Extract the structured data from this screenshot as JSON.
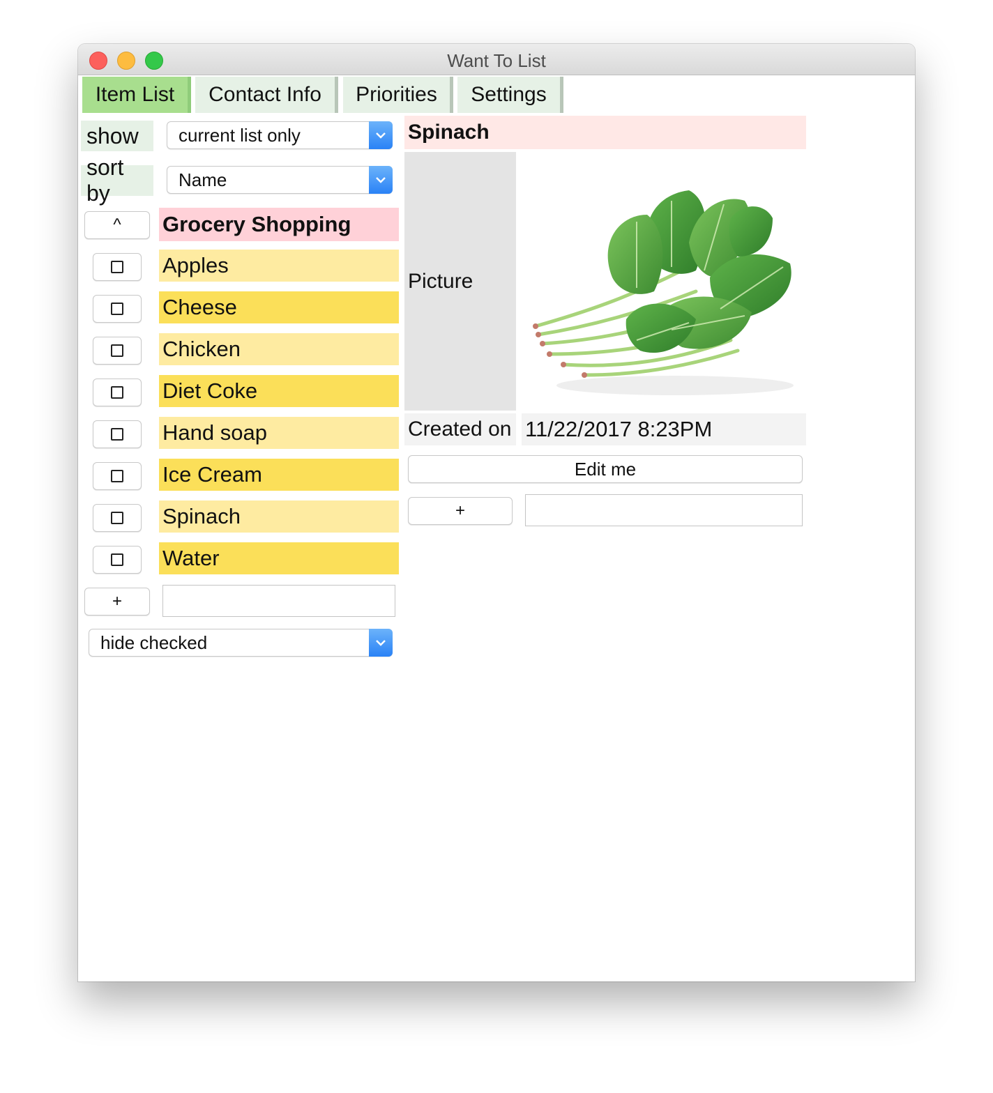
{
  "window": {
    "title": "Want To List"
  },
  "tabs": [
    {
      "label": "Item List",
      "active": true
    },
    {
      "label": "Contact Info",
      "active": false
    },
    {
      "label": "Priorities",
      "active": false
    },
    {
      "label": "Settings",
      "active": false
    }
  ],
  "filters": {
    "show_label": "show",
    "show_value": "current list only",
    "sort_label": "sort by",
    "sort_value": "Name"
  },
  "list": {
    "up_button": "^",
    "title": "Grocery Shopping",
    "items": [
      {
        "label": "Apples",
        "checked": false
      },
      {
        "label": "Cheese",
        "checked": false
      },
      {
        "label": "Chicken",
        "checked": false
      },
      {
        "label": "Diet Coke",
        "checked": false
      },
      {
        "label": "Hand soap",
        "checked": false
      },
      {
        "label": "Ice Cream",
        "checked": false
      },
      {
        "label": "Spinach",
        "checked": false
      },
      {
        "label": "Water",
        "checked": false
      }
    ],
    "add_button": "+",
    "new_item_value": "",
    "checked_filter": "hide checked"
  },
  "detail": {
    "title": "Spinach",
    "picture_label": "Picture",
    "created_label": "Created on",
    "created_value": "11/22/2017 8:23PM",
    "edit_button": "Edit me",
    "add_button": "+",
    "note_value": ""
  },
  "colors": {
    "tab_active": "#a8de8e",
    "tab_inactive": "#e6f1e6",
    "list_title_bg": "#ffd1d8",
    "detail_title_bg": "#ffe8e6",
    "item_light": "#feeba1",
    "item_dark": "#fbdf59",
    "select_arrow": "#2a82f6"
  }
}
